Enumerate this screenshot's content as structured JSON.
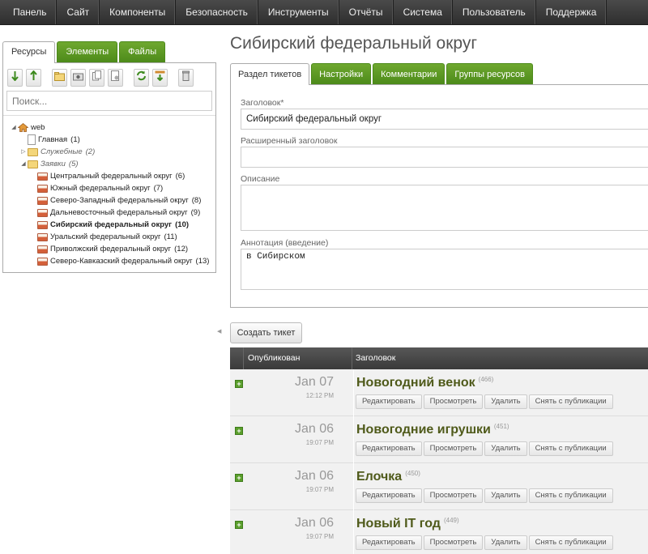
{
  "topnav": [
    "Панель",
    "Сайт",
    "Компоненты",
    "Безопасность",
    "Инструменты",
    "Отчёты",
    "Система",
    "Пользователь",
    "Поддержка"
  ],
  "left_tabs": [
    "Ресурсы",
    "Элементы",
    "Файлы"
  ],
  "toolbar_icons": [
    "arrow-down-icon",
    "arrow-up-icon",
    "new-folder-icon",
    "new-weblink-icon",
    "new-symlink-icon",
    "new-static-icon",
    "refresh-icon",
    "sort-icon",
    "purge-icon"
  ],
  "search": {
    "placeholder": "Поиск..."
  },
  "tree": [
    {
      "label": "web",
      "count": "",
      "icon": "home-icon",
      "level": 0,
      "toggle": "open"
    },
    {
      "label": "Главная",
      "count": "(1)",
      "icon": "page-icon",
      "level": 1,
      "toggle": ""
    },
    {
      "label": "Служебные",
      "count": "(2)",
      "icon": "folder-icon",
      "level": 1,
      "toggle": "closed",
      "style": "italic"
    },
    {
      "label": "Заявки",
      "count": "(5)",
      "icon": "folder-icon",
      "level": 1,
      "toggle": "open",
      "style": "italic"
    },
    {
      "label": "Центральный федеральный округ",
      "count": "(6)",
      "icon": "ticket-icon",
      "level": 2,
      "toggle": ""
    },
    {
      "label": "Южный федеральный округ",
      "count": "(7)",
      "icon": "ticket-icon",
      "level": 2,
      "toggle": ""
    },
    {
      "label": "Северо-Западный федеральный округ",
      "count": "(8)",
      "icon": "ticket-icon",
      "level": 2,
      "toggle": ""
    },
    {
      "label": "Дальневосточный федеральный округ",
      "count": "(9)",
      "icon": "ticket-icon",
      "level": 2,
      "toggle": ""
    },
    {
      "label": "Сибирский федеральный округ",
      "count": "(10)",
      "icon": "ticket-icon",
      "level": 2,
      "toggle": "",
      "style": "bold"
    },
    {
      "label": "Уральский федеральный округ",
      "count": "(11)",
      "icon": "ticket-icon",
      "level": 2,
      "toggle": ""
    },
    {
      "label": "Приволжский федеральный округ",
      "count": "(12)",
      "icon": "ticket-icon",
      "level": 2,
      "toggle": ""
    },
    {
      "label": "Северо-Кавказский федеральный округ",
      "count": "(13)",
      "icon": "ticket-icon",
      "level": 2,
      "toggle": ""
    }
  ],
  "page_title": "Сибирский федеральный округ",
  "main_tabs": [
    "Раздел тикетов",
    "Настройки",
    "Комментарии",
    "Группы ресурсов"
  ],
  "form": {
    "title_label": "Заголовок*",
    "title_value": "Сибирский федеральный округ",
    "longtitle_label": "Расширенный заголовок",
    "longtitle_value": "",
    "description_label": "Описание",
    "description_value": "",
    "introtext_label": "Аннотация (введение)",
    "introtext_value": "в Сибирском"
  },
  "create_button": "Создать тикет",
  "grid": {
    "col_published": "Опубликован",
    "col_title": "Заголовок",
    "actions": [
      "Редактировать",
      "Просмотреть",
      "Удалить",
      "Снять с публикации"
    ],
    "rows": [
      {
        "date": "Jan 07",
        "time": "12:12 PM",
        "title": "Новогодний венок",
        "id": "(466)"
      },
      {
        "date": "Jan 06",
        "time": "19:07 PM",
        "title": "Новогодние игрушки",
        "id": "(451)"
      },
      {
        "date": "Jan 06",
        "time": "19:07 PM",
        "title": "Елочка",
        "id": "(450)"
      },
      {
        "date": "Jan 06",
        "time": "19:07 PM",
        "title": "Новый IT год",
        "id": "(449)"
      }
    ]
  },
  "colors": {
    "accent_green": "#5a9e2b",
    "nav_dark": "#3a3a3a",
    "title_olive": "#4f5a1a"
  }
}
